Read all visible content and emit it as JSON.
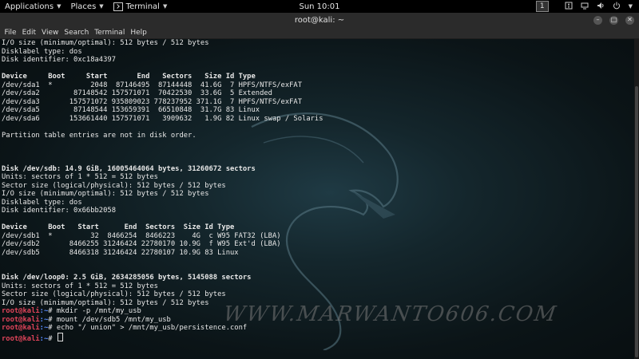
{
  "top_panel": {
    "applications": "Applications",
    "places": "Places",
    "terminal": "Terminal",
    "clock": "Sun 10:01",
    "workspace": "1",
    "icons": [
      "accessibility-icon",
      "network-icon",
      "volume-icon",
      "power-icon"
    ]
  },
  "window": {
    "title": "root@kali: ~",
    "controls": [
      "minimize",
      "maximize",
      "close"
    ]
  },
  "menu": [
    "File",
    "Edit",
    "View",
    "Search",
    "Terminal",
    "Help"
  ],
  "terminal": {
    "lines": [
      {
        "t": "I/O size (minimum/optimal): 512 bytes / 512 bytes"
      },
      {
        "t": "Disklabel type: dos"
      },
      {
        "t": "Disk identifier: 0xc18a4397"
      },
      {
        "t": ""
      },
      {
        "t": "Device     Boot     Start       End   Sectors   Size Id Type",
        "bold": true
      },
      {
        "t": "/dev/sda1  *         2048  87146495  87144448  41.6G  7 HPFS/NTFS/exFAT"
      },
      {
        "t": "/dev/sda2        87148542 157571071  70422530  33.6G  5 Extended"
      },
      {
        "t": "/dev/sda3       157571072 935809023 778237952 371.1G  7 HPFS/NTFS/exFAT"
      },
      {
        "t": "/dev/sda5        87148544 153659391  66510848  31.7G 83 Linux"
      },
      {
        "t": "/dev/sda6       153661440 157571071   3909632   1.9G 82 Linux swap / Solaris"
      },
      {
        "t": ""
      },
      {
        "t": "Partition table entries are not in disk order."
      },
      {
        "t": ""
      },
      {
        "t": ""
      },
      {
        "t": ""
      },
      {
        "t": "Disk /dev/sdb: 14.9 GiB, 16005464064 bytes, 31260672 sectors",
        "bold": true
      },
      {
        "t": "Units: sectors of 1 * 512 = 512 bytes"
      },
      {
        "t": "Sector size (logical/physical): 512 bytes / 512 bytes"
      },
      {
        "t": "I/O size (minimum/optimal): 512 bytes / 512 bytes"
      },
      {
        "t": "Disklabel type: dos"
      },
      {
        "t": "Disk identifier: 0x66bb2058"
      },
      {
        "t": ""
      },
      {
        "t": "Device     Boot   Start      End  Sectors  Size Id Type",
        "bold": true
      },
      {
        "t": "/dev/sdb1  *         32  8466254  8466223    4G  c W95 FAT32 (LBA)"
      },
      {
        "t": "/dev/sdb2       8466255 31246424 22780170 10.9G  f W95 Ext'd (LBA)"
      },
      {
        "t": "/dev/sdb5       8466318 31246424 22780107 10.9G 83 Linux"
      },
      {
        "t": ""
      },
      {
        "t": ""
      },
      {
        "t": "Disk /dev/loop0: 2.5 GiB, 2634285056 bytes, 5145088 sectors",
        "bold": true
      },
      {
        "t": "Units: sectors of 1 * 512 = 512 bytes"
      },
      {
        "t": "Sector size (logical/physical): 512 bytes / 512 bytes"
      },
      {
        "t": "I/O size (minimum/optimal): 512 bytes / 512 bytes"
      }
    ],
    "prompt_user": "root@kali",
    "prompt_path": ":~",
    "prompt_symbol": "# ",
    "commands": [
      "mkdir -p /mnt/my_usb",
      "mount /dev/sdb5 /mnt/my_usb",
      "echo \"/ union\" > /mnt/my_usb/persistence.conf",
      ""
    ]
  },
  "watermark": "WWW.MARWANTO606.COM"
}
